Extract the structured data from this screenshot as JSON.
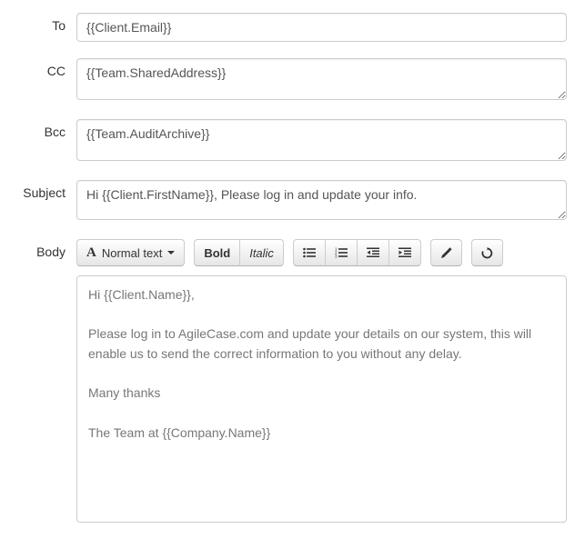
{
  "labels": {
    "to": "To",
    "cc": "CC",
    "bcc": "Bcc",
    "subject": "Subject",
    "body": "Body"
  },
  "fields": {
    "to": "{{Client.Email}}",
    "cc": "{{Team.SharedAddress}}",
    "bcc": "{{Team.AuditArchive}}",
    "subject": "Hi {{Client.FirstName}}, Please log in and update your info."
  },
  "toolbar": {
    "style_label": "Normal text",
    "bold": "Bold",
    "italic": "Italic"
  },
  "body_text": "Hi {{Client.Name}},\n\nPlease log in to AgileCase.com and update your details on our system, this will enable us to send the correct information to you without any delay.\n\nMany thanks\n\nThe Team at {{Company.Name}}"
}
